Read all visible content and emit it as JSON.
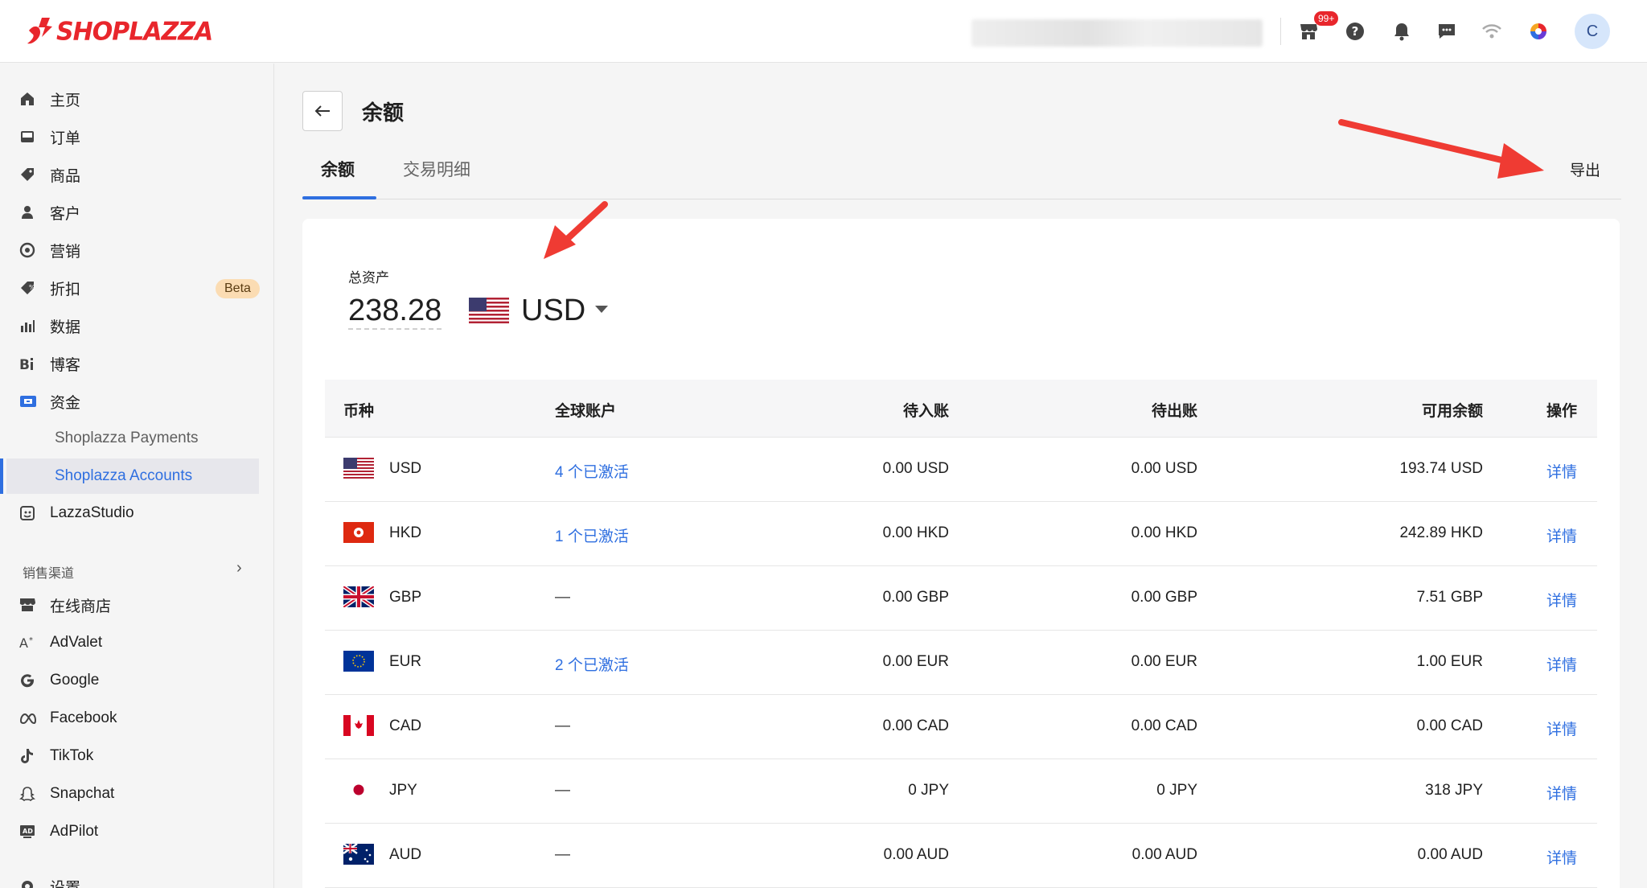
{
  "brand": {
    "name": "SHOPLAZZA",
    "color": "#e8262c"
  },
  "topbar": {
    "notification_badge": "99+",
    "avatar_initial": "C",
    "icons": [
      "store-icon",
      "help-icon",
      "bell-icon",
      "chat-icon",
      "wifi-icon",
      "color-wheel-icon"
    ]
  },
  "sidebar": {
    "items": [
      {
        "label": "主页",
        "icon": "home-icon"
      },
      {
        "label": "订单",
        "icon": "inbox-icon"
      },
      {
        "label": "商品",
        "icon": "tag-icon"
      },
      {
        "label": "客户",
        "icon": "person-icon"
      },
      {
        "label": "营销",
        "icon": "target-icon"
      },
      {
        "label": "折扣",
        "icon": "discount-icon",
        "badge": "Beta"
      },
      {
        "label": "数据",
        "icon": "bar-chart-icon"
      },
      {
        "label": "博客",
        "icon": "blog-icon"
      },
      {
        "label": "资金",
        "icon": "wallet-icon"
      }
    ],
    "sub_items": [
      {
        "label": "Shoplazza Payments",
        "active": false
      },
      {
        "label": "Shoplazza Accounts",
        "active": true
      }
    ],
    "lazza_studio": "LazzaStudio",
    "channels_header": "销售渠道",
    "channels": [
      {
        "label": "在线商店",
        "icon": "store-icon"
      },
      {
        "label": "AdValet",
        "icon": "advalet-icon"
      },
      {
        "label": "Google",
        "icon": "google-icon"
      },
      {
        "label": "Facebook",
        "icon": "meta-icon"
      },
      {
        "label": "TikTok",
        "icon": "tiktok-icon"
      },
      {
        "label": "Snapchat",
        "icon": "snapchat-icon"
      },
      {
        "label": "AdPilot",
        "icon": "adpilot-icon"
      }
    ],
    "settings": "设置"
  },
  "page": {
    "title": "余额",
    "tabs": [
      {
        "label": "余额",
        "active": true
      },
      {
        "label": "交易明细",
        "active": false
      }
    ],
    "export_label": "导出"
  },
  "summary": {
    "label": "总资产",
    "amount": "238.28",
    "currency": "USD"
  },
  "table": {
    "headers": {
      "currency": "币种",
      "global_account": "全球账户",
      "pending_in": "待入账",
      "pending_out": "待出账",
      "available": "可用余额",
      "action": "操作"
    },
    "rows": [
      {
        "currency": "USD",
        "flag": "us",
        "global_account": "4 个已激活",
        "linked": true,
        "pending_in": "0.00 USD",
        "pending_out": "0.00 USD",
        "available": "193.74 USD",
        "action": "详情"
      },
      {
        "currency": "HKD",
        "flag": "hk",
        "global_account": "1 个已激活",
        "linked": true,
        "pending_in": "0.00 HKD",
        "pending_out": "0.00 HKD",
        "available": "242.89 HKD",
        "action": "详情"
      },
      {
        "currency": "GBP",
        "flag": "gb",
        "global_account": "—",
        "linked": false,
        "pending_in": "0.00 GBP",
        "pending_out": "0.00 GBP",
        "available": "7.51 GBP",
        "action": "详情"
      },
      {
        "currency": "EUR",
        "flag": "eu",
        "global_account": "2 个已激活",
        "linked": true,
        "pending_in": "0.00 EUR",
        "pending_out": "0.00 EUR",
        "available": "1.00 EUR",
        "action": "详情"
      },
      {
        "currency": "CAD",
        "flag": "ca",
        "global_account": "—",
        "linked": false,
        "pending_in": "0.00 CAD",
        "pending_out": "0.00 CAD",
        "available": "0.00 CAD",
        "action": "详情"
      },
      {
        "currency": "JPY",
        "flag": "jp",
        "global_account": "—",
        "linked": false,
        "pending_in": "0 JPY",
        "pending_out": "0 JPY",
        "available": "318 JPY",
        "action": "详情"
      },
      {
        "currency": "AUD",
        "flag": "au",
        "global_account": "—",
        "linked": false,
        "pending_in": "0.00 AUD",
        "pending_out": "0.00 AUD",
        "available": "0.00 AUD",
        "action": "详情"
      }
    ]
  },
  "colors": {
    "accent": "#2f6fe0",
    "annotation_arrow": "#ef3b33"
  }
}
